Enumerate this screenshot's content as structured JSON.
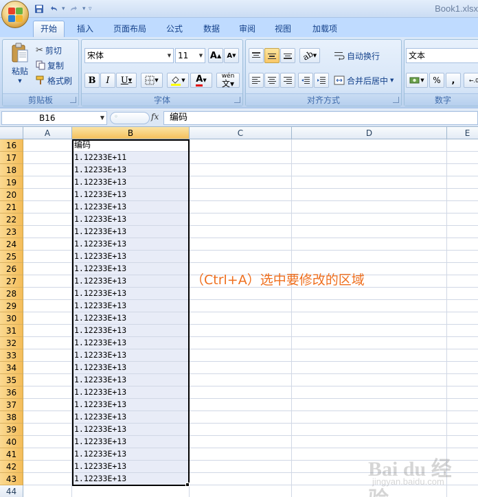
{
  "window": {
    "title": "Book1.xlsx",
    "quick_access": [
      "save-icon",
      "undo-icon",
      "redo-icon",
      "customize-icon"
    ]
  },
  "tabs": [
    {
      "label": "开始",
      "active": true
    },
    {
      "label": "插入"
    },
    {
      "label": "页面布局"
    },
    {
      "label": "公式"
    },
    {
      "label": "数据"
    },
    {
      "label": "审阅"
    },
    {
      "label": "视图"
    },
    {
      "label": "加载项"
    }
  ],
  "ribbon": {
    "clipboard": {
      "label": "剪贴板",
      "paste": "粘贴",
      "cut": "剪切",
      "copy": "复制",
      "format_painter": "格式刷"
    },
    "font": {
      "label": "字体",
      "font_name": "宋体",
      "font_size": "11",
      "bold": "B",
      "italic": "I",
      "underline": "U",
      "grow": "A",
      "shrink": "A",
      "font_color": "A",
      "phonetic": "wén"
    },
    "alignment": {
      "label": "对齐方式",
      "wrap_text": "自动换行",
      "merge_center": "合并后居中"
    },
    "number": {
      "label": "数字",
      "format": "文本",
      "percent": "%",
      "comma": ","
    }
  },
  "formula_bar": {
    "name_box": "B16",
    "fx": "fx",
    "content": "编码"
  },
  "sheet": {
    "columns": [
      "A",
      "B",
      "C",
      "D",
      "E"
    ],
    "selected_column": "B",
    "rows": [
      {
        "n": "16",
        "b": "编码"
      },
      {
        "n": "17",
        "b": "1.12233E+11"
      },
      {
        "n": "18",
        "b": "1.12233E+13"
      },
      {
        "n": "19",
        "b": "1.12233E+13"
      },
      {
        "n": "20",
        "b": "1.12233E+13"
      },
      {
        "n": "21",
        "b": "1.12233E+13"
      },
      {
        "n": "22",
        "b": "1.12233E+13"
      },
      {
        "n": "23",
        "b": "1.12233E+13"
      },
      {
        "n": "24",
        "b": "1.12233E+13"
      },
      {
        "n": "25",
        "b": "1.12233E+13"
      },
      {
        "n": "26",
        "b": "1.12233E+13"
      },
      {
        "n": "27",
        "b": "1.12233E+13"
      },
      {
        "n": "28",
        "b": "1.12233E+13"
      },
      {
        "n": "29",
        "b": "1.12233E+13"
      },
      {
        "n": "30",
        "b": "1.12233E+13"
      },
      {
        "n": "31",
        "b": "1.12233E+13"
      },
      {
        "n": "32",
        "b": "1.12233E+13"
      },
      {
        "n": "33",
        "b": "1.12233E+13"
      },
      {
        "n": "34",
        "b": "1.12233E+13"
      },
      {
        "n": "35",
        "b": "1.12233E+13"
      },
      {
        "n": "36",
        "b": "1.12233E+13"
      },
      {
        "n": "37",
        "b": "1.12233E+13"
      },
      {
        "n": "38",
        "b": "1.12233E+13"
      },
      {
        "n": "39",
        "b": "1.12233E+13"
      },
      {
        "n": "40",
        "b": "1.12233E+13"
      },
      {
        "n": "41",
        "b": "1.12233E+13"
      },
      {
        "n": "42",
        "b": "1.12233E+13"
      },
      {
        "n": "43",
        "b": "1.12233E+13"
      },
      {
        "n": "44",
        "b": ""
      }
    ]
  },
  "annotation": "（Ctrl+A）选中要修改的区域",
  "watermark": {
    "logo": "Bai du 经验",
    "url": "jingyan.baidu.com"
  }
}
